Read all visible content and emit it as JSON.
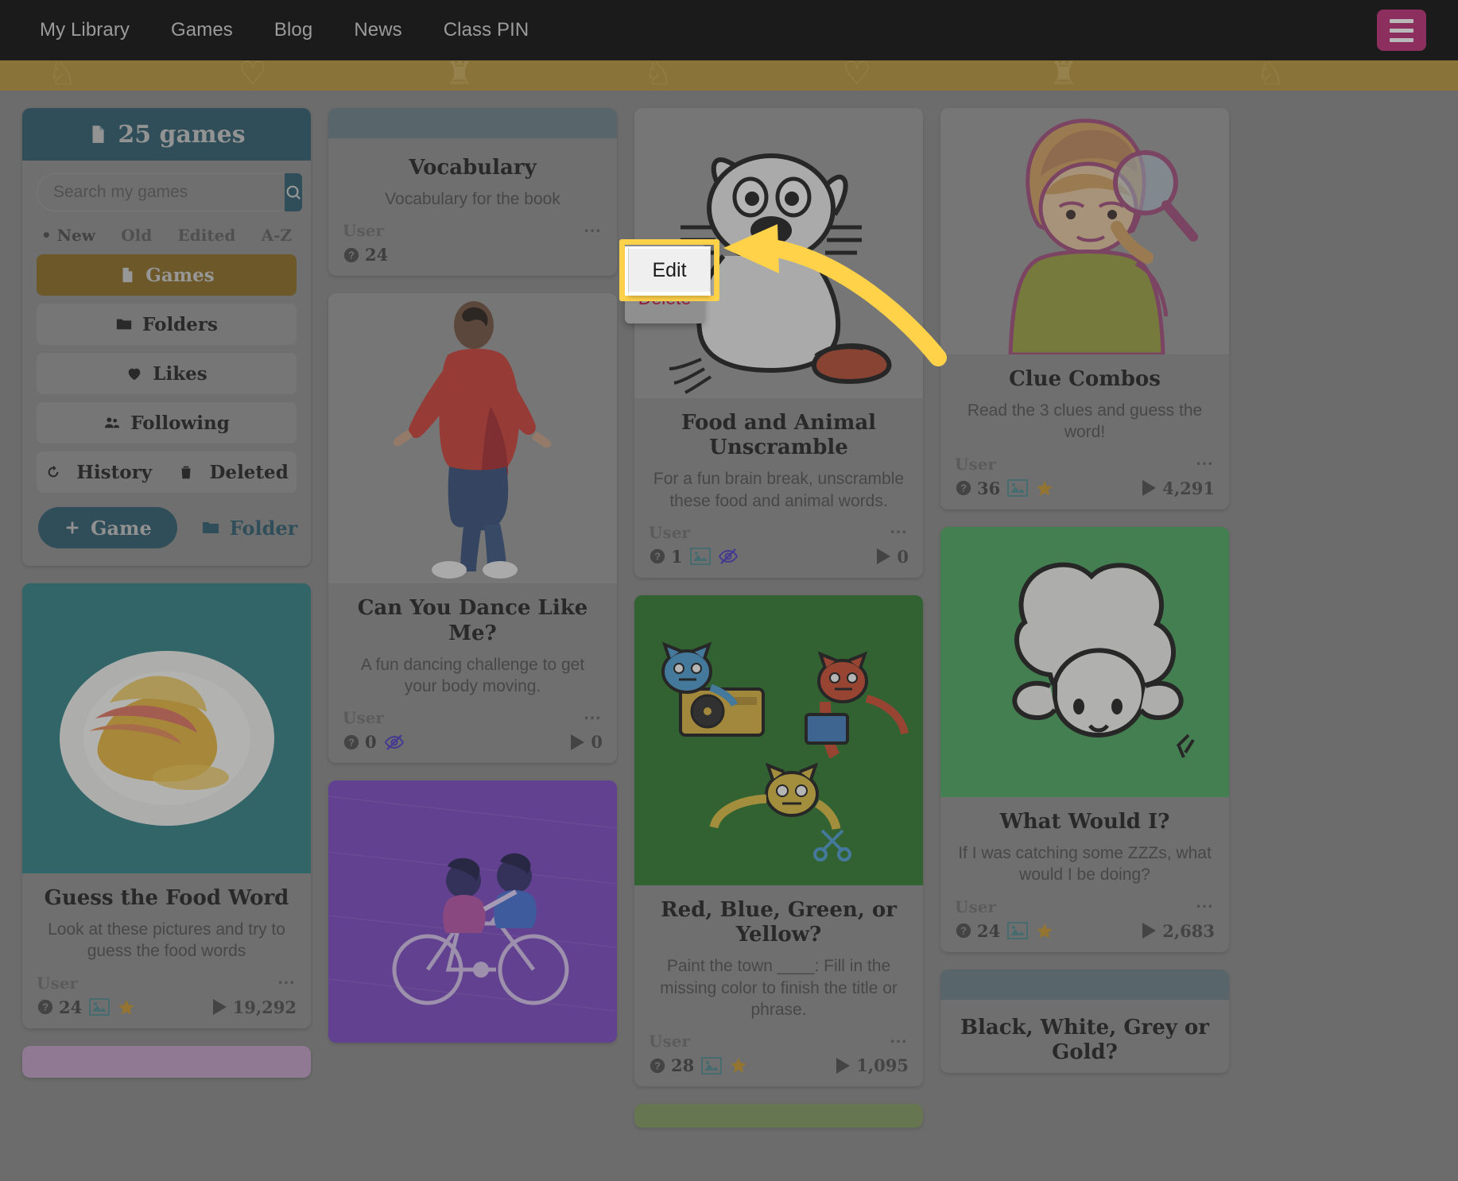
{
  "topnav": {
    "links": [
      {
        "label": "My Library"
      },
      {
        "label": "Games"
      },
      {
        "label": "Blog"
      },
      {
        "label": "News"
      },
      {
        "label": "Class PIN"
      }
    ],
    "menu_button": "menu-icon"
  },
  "sidebar": {
    "header": {
      "count_label": "25 games",
      "icon": "file-icon"
    },
    "search": {
      "placeholder": "Search my games",
      "value": "",
      "button_icon": "search-icon"
    },
    "sorts": [
      {
        "label": "New",
        "active": true
      },
      {
        "label": "Old",
        "active": false
      },
      {
        "label": "Edited",
        "active": false
      },
      {
        "label": "A-Z",
        "active": false
      }
    ],
    "nav": [
      {
        "label": "Games",
        "icon": "file-icon",
        "active": true
      },
      {
        "label": "Folders",
        "icon": "folder-icon",
        "active": false
      },
      {
        "label": "Likes",
        "icon": "heart-icon",
        "active": false
      },
      {
        "label": "Following",
        "icon": "users-icon",
        "active": false
      }
    ],
    "split_row": [
      {
        "label": "History",
        "icon": "history-icon"
      },
      {
        "label": "Deleted",
        "icon": "trash-icon"
      }
    ],
    "actions": {
      "game_button": "Game",
      "folder_button": "Folder"
    }
  },
  "context_menu": {
    "edit_label": "Edit",
    "delete_label": "Delete",
    "highlighted": "Edit"
  },
  "colors": {
    "nav_bg": "#1b1b1b",
    "banner": "#8a7338",
    "accent_teal": "#27596b",
    "accent_gold": "#8a6a1c",
    "highlight_yellow": "#ffd24a",
    "delete_red": "#8b1f3a",
    "card_bg": "#8f8f8f",
    "card_topbar": "#6a7e86",
    "menu_button": "#8c2f5e"
  },
  "cards": {
    "vocabulary": {
      "title": "Vocabulary",
      "description": "Vocabulary for the book",
      "user": "User",
      "questions": "24",
      "has_image_icon": false,
      "has_star": false,
      "hidden": false,
      "plays": "",
      "image_kind": "none",
      "more_icon": "more-options-icon"
    },
    "dance": {
      "title": "Can You Dance Like Me?",
      "description": "A fun dancing challenge to get your body moving.",
      "user": "User",
      "questions": "0",
      "has_image_icon": false,
      "has_star": false,
      "hidden": true,
      "plays": "0",
      "image_kind": "dancer-photo",
      "more_icon": "more-options-icon"
    },
    "food_animal": {
      "title": "Food and Animal Unscramble",
      "description": "For a fun brain break, unscramble these food and animal words.",
      "user": "User",
      "questions": "1",
      "has_image_icon": true,
      "has_star": false,
      "hidden": true,
      "plays": "0",
      "image_kind": "cat-drawing",
      "more_icon": "more-options-icon"
    },
    "clue_combos": {
      "title": "Clue Combos",
      "description": "Read the 3 clues and guess the word!",
      "user": "User",
      "questions": "36",
      "has_image_icon": true,
      "has_star": true,
      "hidden": false,
      "plays": "4,291",
      "image_kind": "magnifier-girl",
      "more_icon": "more-options-icon"
    },
    "guess_food": {
      "title": "Guess the Food Word",
      "description": "Look at these pictures and try to guess the food words",
      "user": "User",
      "questions": "24",
      "has_image_icon": true,
      "has_star": true,
      "hidden": false,
      "plays": "19,292",
      "image_kind": "sandwich-photo",
      "more_icon": "more-options-icon"
    },
    "red_blue": {
      "title": "Red, Blue, Green, or Yellow?",
      "description": "Paint the town ____: Fill in the missing color to finish the title or phrase.",
      "user": "User",
      "questions": "28",
      "has_image_icon": true,
      "has_star": true,
      "hidden": false,
      "plays": "1,095",
      "image_kind": "cats-dj",
      "more_icon": "more-options-icon"
    },
    "what_would_i": {
      "title": "What Would I?",
      "description": "If I was catching some ZZZs, what would I be doing?",
      "user": "User",
      "questions": "24",
      "has_image_icon": true,
      "has_star": true,
      "hidden": false,
      "plays": "2,683",
      "image_kind": "sheep-drawing",
      "more_icon": "more-options-icon"
    },
    "black_white": {
      "title": "Black, White, Grey or Gold?",
      "description": "",
      "user": "",
      "questions": "",
      "plays": "",
      "image_kind": "none",
      "more_icon": "more-options-icon"
    },
    "bike": {
      "title": "",
      "description": "",
      "image_kind": "bike-couple"
    }
  }
}
